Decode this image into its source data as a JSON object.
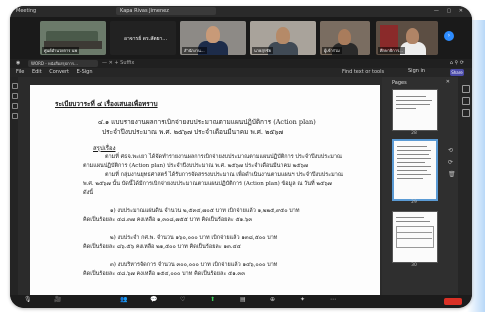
{
  "zoom_top": {
    "app": "Meeting",
    "share_title": "Kapa Rivas Jimenez",
    "window_ctrls": "— ▢ ✕"
  },
  "participants": [
    {
      "name": "ศูนย์อำนวยการ นพ",
      "bg": "#6b7a6a",
      "shirt": "#2c3e50"
    },
    {
      "name": "อาจารย์ ดร.สัตยา...",
      "bg": "#222222",
      "shirt": "#1f1f1f"
    },
    {
      "name": "สำนักงาน...",
      "bg": "#8d8a86",
      "shirt": "#1d2c4a"
    },
    {
      "name": "นายสุรชัย",
      "bg": "#a9a39b",
      "shirt": "#404a55"
    },
    {
      "name": "ผู้เข้าร่วม",
      "bg": "#7a6d61",
      "shirt": "#2a2a2a"
    },
    {
      "name": "ศึกษาธิการ...",
      "bg": "#5c4e43",
      "shirt": "#ececec"
    }
  ],
  "toolbar2": {
    "logo": "◉",
    "tab_label": "WORD - หนังสือสรุปการ...",
    "mid": "— ✕ + Suffix",
    "right": "⌂ ⚲ ⟳"
  },
  "menu": [
    "File",
    "Edit",
    "Convert",
    "E-Sign"
  ],
  "find_text": "Find text or tools",
  "sign_in": "Sign in",
  "share_label": "Share",
  "document": {
    "title": "ระเบียบวาระที่ ๔  เรื่องเสนอเพื่อทราบ",
    "heading1": "๔.๑ แบบรายงานผลการเบิกจ่ายงบประมาณตามแผนปฏิบัติการ (Action plan)",
    "heading2": "ประจำปีงบประมาณ พ.ศ. ๒๕๖๗ ประจำเดือนมีนาคม พ.ศ. ๒๕๖๗",
    "subhead": "สรุปเรื่อง",
    "para1": [
      "ตามที่ ศธจ.พะเยา ได้จัดทำรายงานผลการเบิกจ่ายงบประมาณตามแผนปฏิบัติการ ประจำปีงบประมาณ",
      "ตามแผนปฏิบัติการ (Action plan) ประจำปีงบประมาณ พ.ศ. ๒๕๖๗ ประจำเดือนมีนาคม ๒๕๖๗",
      "ตามที่ กลุ่มงานยุทธศาสตร์ ได้รับการจัดสรรงบประมาณ เพื่อดำเนินงานตามแผนฯ ประจำปีงบประมาณ",
      "พ.ศ. ๒๕๖๗ นั้น บัดนี้ได้มีการเบิกจ่ายงบประมาณตามแผนปฏิบัติการ (Action plan) ข้อมูล ณ วันที่ ๒๕๖๗",
      "ดังนี้"
    ],
    "item1": [
      "๑) งบประมาณแผ่นดิน จำนวน ๒,๕๓๔,๗๐๕ บาท เบิกจ่ายแล้ว ๑,๒๒๕,๙๕๐ บาท",
      "คิดเป็นร้อยละ ๔๘.๓๗ คงเหลือ ๑,๓๐๘,๗๕๕ บาท คิดเป็นร้อยละ ๕๑.๖๓"
    ],
    "item2": [
      "๒) งบประจำ กศ.พ. จำนวน ๑๖๐,๐๐๐ บาท เบิกจ่ายแล้ว ๑๓๘,๕๐๐ บาท",
      "คิดเป็นร้อยละ ๘๖.๕๖ คงเหลือ ๒๑,๕๐๐ บาท คิดเป็นร้อยละ ๑๓.๔๔"
    ],
    "item3": [
      "๓) งบบริหารจัดการ จำนวน ๓๐๐,๐๐๐ บาท เบิกจ่ายแล้ว ๑๔๖,๐๐๐ บาท",
      "คิดเป็นร้อยละ ๔๘.๖๗ คงเหลือ ๑๕๔,๐๐๐ บาท คิดเป็นร้อยละ ๕๑.๓๓"
    ]
  },
  "pages_panel": {
    "title": "Pages",
    "close": "✕",
    "page_numbers": [
      "28",
      "29",
      "30"
    ]
  },
  "side_icons": [
    "⟲",
    "⟳",
    "🗑"
  ],
  "bottom_controls": [
    {
      "icon": "🎙",
      "label": "Mic"
    },
    {
      "icon": "🎥",
      "label": "Video"
    },
    {
      "icon": "👥",
      "label": "Participants"
    },
    {
      "icon": "💬",
      "label": "Chat"
    },
    {
      "icon": "♡",
      "label": "React"
    },
    {
      "icon": "⬆",
      "label": "Share"
    },
    {
      "icon": "▤",
      "label": "Host tools"
    },
    {
      "icon": "⊕",
      "label": "Apps"
    },
    {
      "icon": "✦",
      "label": "AI Companion"
    },
    {
      "icon": "⋯",
      "label": "More"
    }
  ],
  "leave_color": "#d93025"
}
